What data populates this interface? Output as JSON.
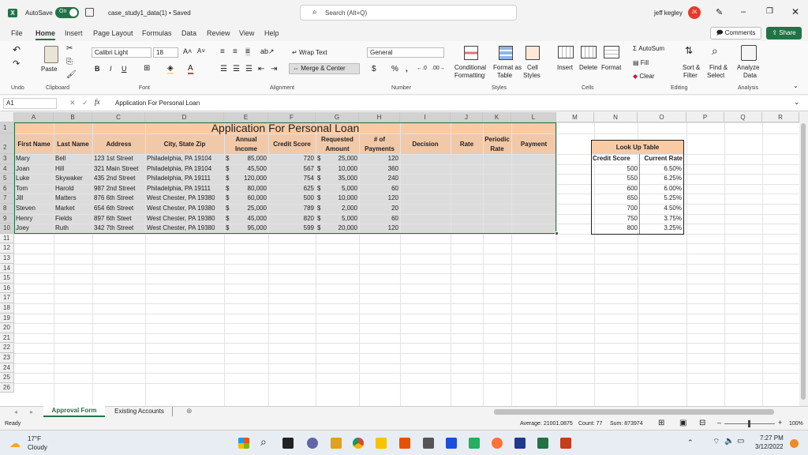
{
  "titlebar": {
    "autosave_label": "AutoSave",
    "autosave_state": "On",
    "filename": "case_study1_data(1) • Saved",
    "search_placeholder": "Search (Alt+Q)",
    "user_name": "jeff kegley",
    "user_initials": "JK"
  },
  "menu": {
    "tabs": [
      "File",
      "Home",
      "Insert",
      "Page Layout",
      "Formulas",
      "Data",
      "Review",
      "View",
      "Help"
    ],
    "active": "Home",
    "comments": "Comments",
    "share": "Share"
  },
  "ribbon": {
    "undo": "Undo",
    "paste": "Paste",
    "clipboard": "Clipboard",
    "font_name": "Calibri Light",
    "font_size": "18",
    "font": "Font",
    "wrap_text": "Wrap Text",
    "merge_center": "Merge & Center",
    "alignment": "Alignment",
    "number_format": "General",
    "number": "Number",
    "conditional": "Conditional",
    "formatting": "Formatting",
    "format_as": "Format as",
    "table": "Table",
    "cell": "Cell",
    "styles_btn": "Styles",
    "styles": "Styles",
    "insert": "Insert",
    "delete": "Delete",
    "format": "Format",
    "cells": "Cells",
    "autosum": "AutoSum",
    "fill": "Fill",
    "clear": "Clear",
    "sort_filter_1": "Sort &",
    "sort_filter_2": "Filter",
    "find_select_1": "Find &",
    "find_select_2": "Select",
    "editing": "Editing",
    "analyze_1": "Analyze",
    "analyze_2": "Data",
    "analysis": "Analysis"
  },
  "formula_bar": {
    "name_box": "A1",
    "fx": "fx",
    "content": "Application For Personal Loan"
  },
  "columns": [
    "A",
    "B",
    "C",
    "D",
    "E",
    "F",
    "G",
    "H",
    "I",
    "J",
    "K",
    "L",
    "M",
    "N",
    "O",
    "P",
    "Q",
    "R"
  ],
  "rows": [
    "1",
    "2",
    "3",
    "4",
    "5",
    "6",
    "7",
    "8",
    "9",
    "10",
    "11",
    "12",
    "13",
    "14",
    "15",
    "16",
    "17",
    "18",
    "19",
    "20",
    "21",
    "22",
    "23",
    "24",
    "25",
    "26"
  ],
  "sheet": {
    "title": "Application For Personal Loan",
    "headers": {
      "first_name": "First Name",
      "last_name": "Last Name",
      "address": "Address",
      "city": "City, State Zip",
      "annual_1": "Annual",
      "annual_2": "Income",
      "credit": "Credit Score",
      "requested_1": "Requested",
      "requested_2": "Amount",
      "payments_1": "# of",
      "payments_2": "Payments",
      "decision": "Decision",
      "rate": "Rate",
      "periodic_1": "Periodic",
      "periodic_2": "Rate",
      "payment": "Payment"
    },
    "data": [
      [
        "Mary",
        "Bell",
        "123 1st Street",
        "Philadelphia, PA 19104",
        "$",
        "85,000",
        "720",
        "$",
        "25,000",
        "120"
      ],
      [
        "Joan",
        "Hill",
        "321 Main Street",
        "Philadelphia, PA 19104",
        "$",
        "45,500",
        "567",
        "$",
        "10,000",
        "360"
      ],
      [
        "Luke",
        "Skywaker",
        "435 2nd Street",
        "Philadelphia, PA 19111",
        "$",
        "120,000",
        "754",
        "$",
        "35,000",
        "240"
      ],
      [
        "Tom",
        "Harold",
        "987 2nd Street",
        "Philadelphia, PA 19111",
        "$",
        "80,000",
        "625",
        "$",
        "5,000",
        "60"
      ],
      [
        "Jill",
        "Matters",
        "876 6th Street",
        "West Chester, PA 19380",
        "$",
        "60,000",
        "500",
        "$",
        "10,000",
        "120"
      ],
      [
        "Steven",
        "Market",
        "654 6th Street",
        "West Chester, PA 19380",
        "$",
        "25,000",
        "789",
        "$",
        "2,000",
        "20"
      ],
      [
        "Henry",
        "Fields",
        "897 6th Steet",
        "West Chester, PA 19380",
        "$",
        "45,000",
        "820",
        "$",
        "5,000",
        "60"
      ],
      [
        "Joey",
        "Ruth",
        "342 7th Street",
        "West Chester, PA 19380",
        "$",
        "95,000",
        "599",
        "$",
        "20,000",
        "120"
      ]
    ],
    "lookup": {
      "title": "Look Up Table",
      "col1": "Credit Score",
      "col2": "Current Rate",
      "rows": [
        [
          "500",
          "6.50%"
        ],
        [
          "550",
          "6.25%"
        ],
        [
          "600",
          "6.00%"
        ],
        [
          "650",
          "5.25%"
        ],
        [
          "700",
          "4.50%"
        ],
        [
          "750",
          "3.75%"
        ],
        [
          "800",
          "3.25%"
        ]
      ]
    }
  },
  "sheet_tabs": [
    "Approval Form",
    "Existing Accounts"
  ],
  "status": {
    "ready": "Ready",
    "average": "Average: 21001.0875",
    "count": "Count: 77",
    "sum": "Sum: 873974",
    "zoom": "100%"
  },
  "taskbar": {
    "temp": "17°F",
    "weather": "Cloudy",
    "time": "7:27 PM",
    "date": "3/12/2022"
  },
  "colors": {
    "accent": "#217346",
    "title_fill": "#f8cba5",
    "header_fill": "#f2c9a8",
    "selection": "#dcdcdc"
  }
}
